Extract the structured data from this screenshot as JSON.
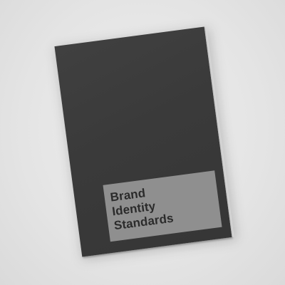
{
  "cover": {
    "title_lines": [
      "Brand",
      "Identity",
      "Standards"
    ],
    "colors": {
      "background": "#e6e6e6",
      "cover": "#3a3a3a",
      "label_panel": "#8f8f8f",
      "title_text": "#2b2b2b"
    }
  }
}
